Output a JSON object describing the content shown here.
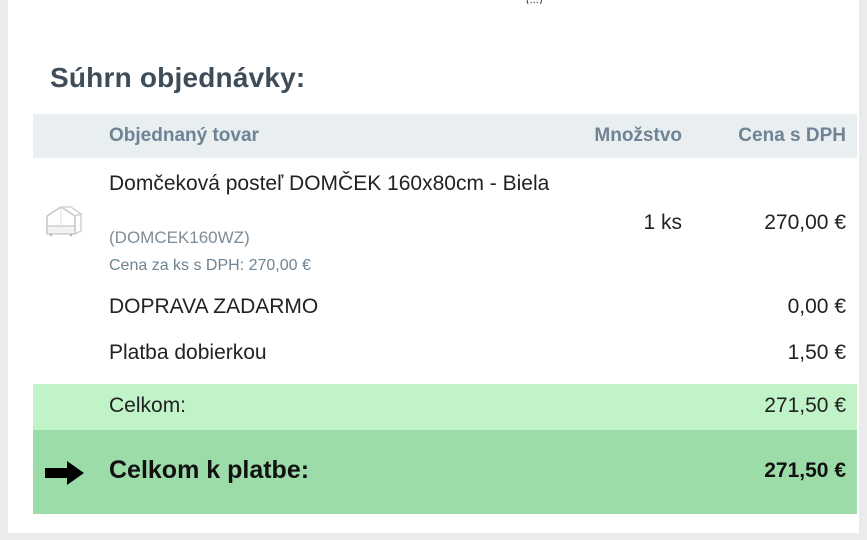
{
  "top_fragment": "(...)",
  "summary_title": "Súhrn objednávky:",
  "table": {
    "headers": {
      "item": "Objednaný tovar",
      "quantity": "Množstvo",
      "price": "Cena s DPH"
    },
    "product": {
      "name": "Domčeková posteľ DOMČEK 160x80cm - Biela",
      "code": "(DOMCEK160WZ)",
      "unit_price": "Cena za ks s DPH: 270,00 €",
      "quantity": "1 ks",
      "price": "270,00 €",
      "thumbnail_icon": "bed-house-icon"
    },
    "shipping": {
      "label": "DOPRAVA ZADARMO",
      "price": "0,00 €"
    },
    "payment": {
      "label": "Platba dobierkou",
      "price": "1,50 €"
    },
    "subtotal": {
      "label": "Celkom:",
      "price": "271,50 €",
      "color": "#c0f3c7"
    },
    "grand_total": {
      "label": "Celkom k platbe:",
      "price": "271,50 €",
      "icon": "arrow-right-icon",
      "color": "#9bdca8"
    }
  }
}
